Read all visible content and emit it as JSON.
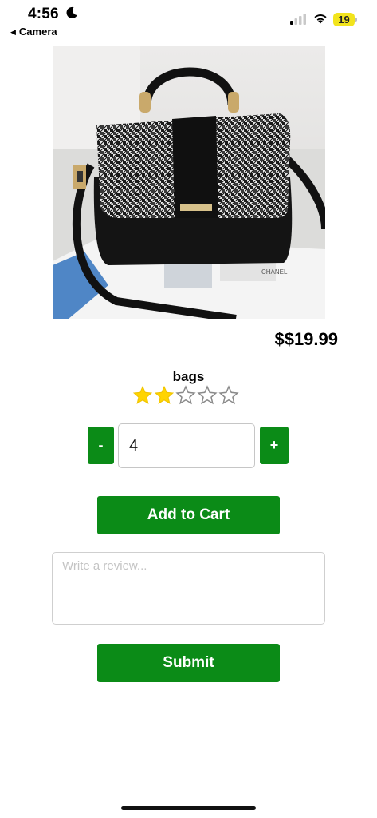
{
  "status_bar": {
    "time": "4:56",
    "back_label": "Camera",
    "back_icon": "triangle-left",
    "battery_level": "19",
    "battery_color": "#f2e41d",
    "signal_bars_active": 1,
    "signal_bars_total": 4
  },
  "product": {
    "image_icon": "handbag-photo",
    "price": "$$19.99",
    "name": "bags",
    "rating": 2,
    "rating_max": 5,
    "star_filled_color": "#ffd400"
  },
  "quantity": {
    "minus_label": "-",
    "value": "4",
    "plus_label": "+"
  },
  "actions": {
    "add_to_cart_label": "Add to Cart",
    "submit_label": "Submit",
    "button_color": "#0b8b17"
  },
  "review": {
    "placeholder": "Write a review...",
    "value": ""
  }
}
